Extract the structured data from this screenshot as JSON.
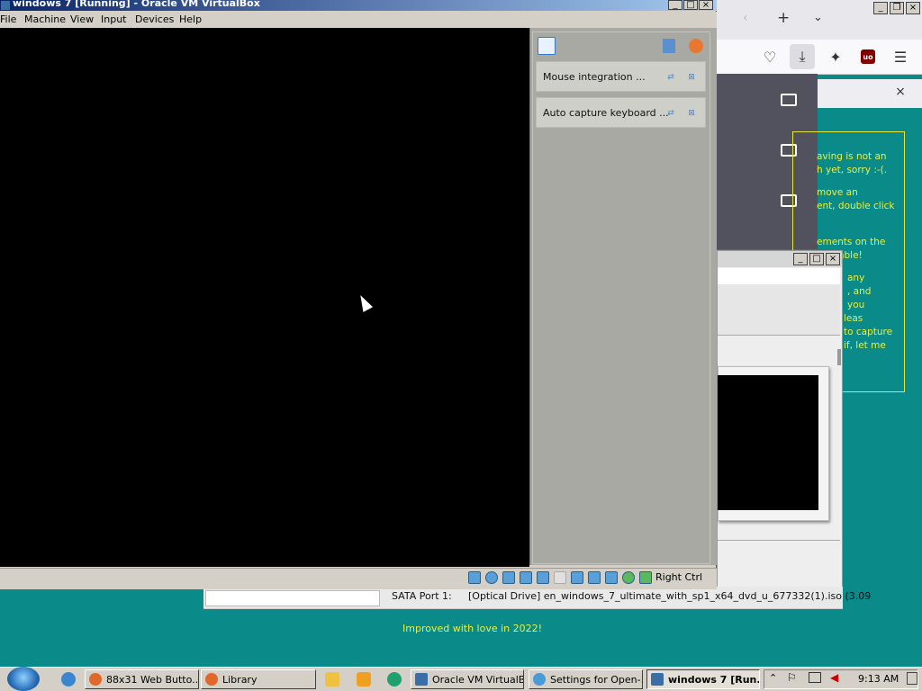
{
  "vbox": {
    "title": "windows 7 [Running] - Oracle VM VirtualBox",
    "menu": [
      "File",
      "Machine",
      "View",
      "Input",
      "Devices",
      "Help"
    ],
    "notifications": [
      {
        "text": "Mouse integration ..."
      },
      {
        "text": "Auto capture keyboard ..."
      }
    ],
    "host_key": "Right Ctrl"
  },
  "browser": {
    "panel_close": "×"
  },
  "page": {
    "side_text_lines": [
      "aving is not an",
      "h yet, sorry :-(.",
      "move an",
      "ent, double click",
      "ements on the",
      "raggable!",
      "any",
      ", and",
      "you",
      "leas",
      "to capture",
      "if, let me"
    ],
    "footer": "Improved with love in 2022!"
  },
  "storage": {
    "label": "SATA Port 1:",
    "value": "[Optical Drive] en_windows_7_ultimate_with_sp1_x64_dvd_u_677332(1).iso (3.09"
  },
  "taskbar": {
    "buttons": [
      {
        "label": "88x31 Web Butto..."
      },
      {
        "label": "Library"
      },
      {
        "label": "Oracle VM VirtualB..."
      },
      {
        "label": "Settings for Open-..."
      },
      {
        "label": "windows 7 [Run..."
      }
    ],
    "clock": "9:13 AM"
  },
  "colors": {
    "desktop": "#0b8a8a",
    "page_text": "#e8f040",
    "vm_screen": "#000000"
  }
}
